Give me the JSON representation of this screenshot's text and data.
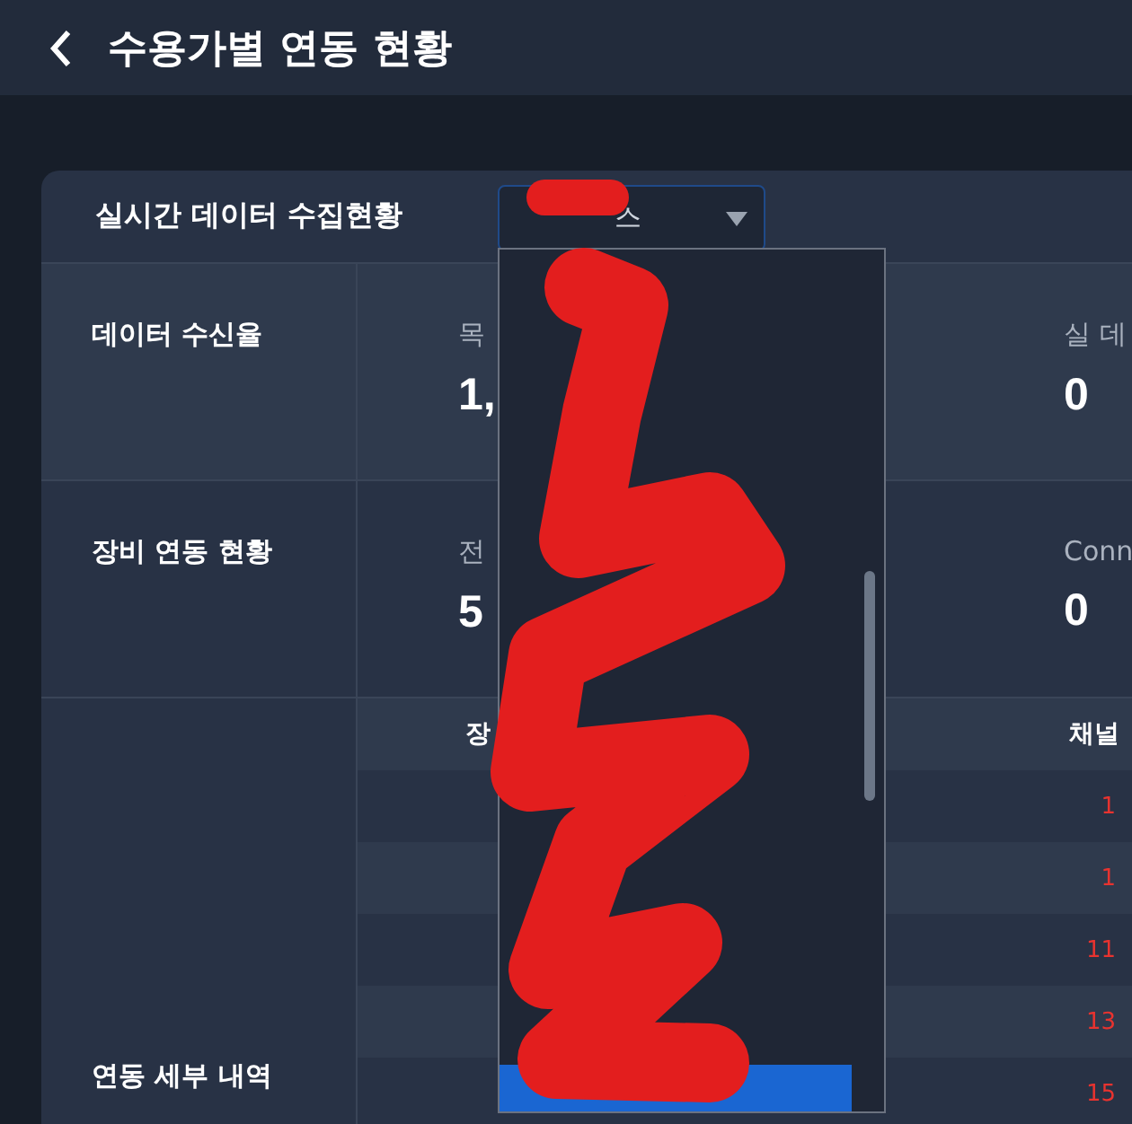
{
  "header": {
    "title": "수용가별 연동 현황"
  },
  "card": {
    "title": "실시간 데이터 수집현황",
    "dropdown": {
      "value": "스",
      "expanded": true,
      "options": [
        {
          "selected": true
        }
      ]
    },
    "rows": [
      {
        "label": "데이터 수신율",
        "metrics": [
          {
            "label": "목",
            "value": "1,"
          },
          {
            "label": "실 데",
            "value": "0"
          }
        ]
      },
      {
        "label": "장비 연동 현황",
        "metrics": [
          {
            "label": "전",
            "value": "5"
          },
          {
            "label": "Conn",
            "value": "0"
          }
        ]
      }
    ],
    "detail": {
      "label": "연동 세부 내역",
      "columns": [
        "장",
        "채널"
      ],
      "rows": [
        {
          "column_2": "1"
        },
        {
          "column_2": "1"
        },
        {
          "column_2": "11"
        },
        {
          "column_2": "13"
        },
        {
          "column_2": "15"
        }
      ]
    }
  }
}
